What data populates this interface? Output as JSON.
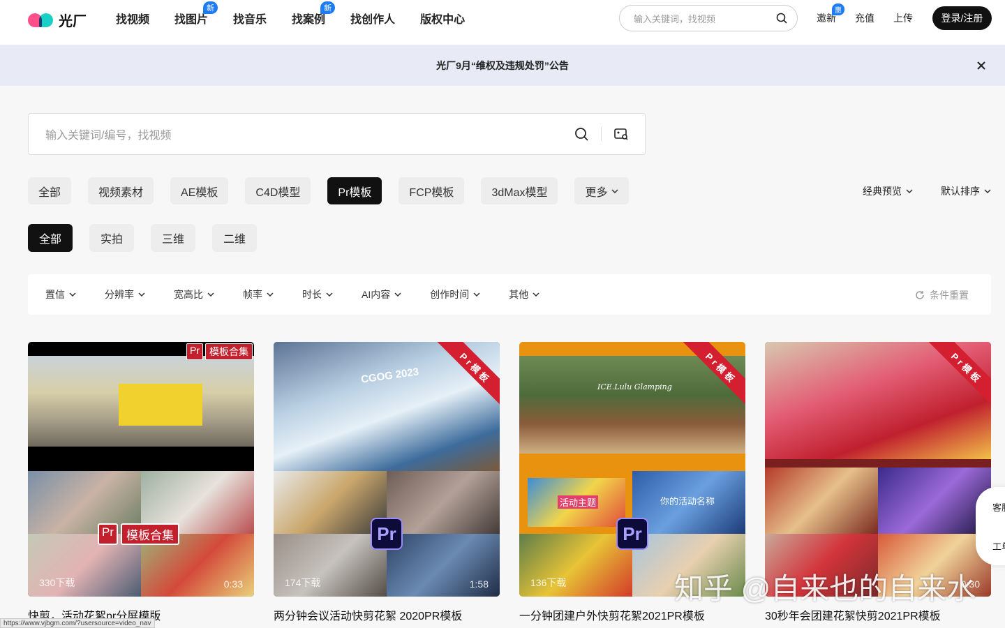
{
  "header": {
    "logo_text": "光厂",
    "nav": [
      {
        "label": "找视频",
        "badge": ""
      },
      {
        "label": "找图片",
        "badge": "新"
      },
      {
        "label": "找音乐",
        "badge": ""
      },
      {
        "label": "找案例",
        "badge": "新"
      },
      {
        "label": "找创作人",
        "badge": ""
      },
      {
        "label": "版权中心",
        "badge": ""
      }
    ],
    "search_placeholder": "输入关键词，找视频",
    "links": {
      "invite": "邀新",
      "invite_badge": "惠",
      "recharge": "充值",
      "upload": "上传"
    },
    "login_label": "登录/注册"
  },
  "notice": {
    "text": "光厂9月“维权及违规处罚”公告"
  },
  "main_search": {
    "placeholder": "输入关键词/编号，找视频"
  },
  "categories": {
    "items": [
      "全部",
      "视频素材",
      "AE模板",
      "C4D模型",
      "Pr模板",
      "FCP模板",
      "3dMax模型",
      "更多"
    ],
    "active": "Pr模板"
  },
  "sorts": {
    "preview": "经典预览",
    "order": "默认排序"
  },
  "subcategories": {
    "items": [
      "全部",
      "实拍",
      "三维",
      "二维"
    ],
    "active": "全部"
  },
  "filters": {
    "items": [
      "置信",
      "分辨率",
      "宽高比",
      "帧率",
      "时长",
      "AI内容",
      "创作时间",
      "其他"
    ],
    "reset": "条件重置"
  },
  "cards": [
    {
      "title": "快剪，活动花絮pr分屏模版",
      "downloads": "330下载",
      "duration": "0:33",
      "tag": "模板合集",
      "tag_pr": "Pr"
    },
    {
      "title": "两分钟会议活动快剪花絮 2020PR模板",
      "downloads": "174下载",
      "duration": "1:58",
      "ribbon": "Pr模板",
      "pr_icon": "Pr",
      "overlay_text": "CGOG 2023"
    },
    {
      "title": "一分钟团建户外快剪花絮2021PR模板",
      "downloads": "136下载",
      "duration": "",
      "ribbon": "Pr模板",
      "pr_icon": "Pr",
      "overlay_text_1": "活动主题",
      "overlay_text_2": "你的活动名称",
      "overlay_text_3": "ICE.Lulu Glamping"
    },
    {
      "title": "30秒年会团建花絮快剪2021PR模板",
      "downloads": "",
      "duration": "0:30",
      "ribbon": "Pr模板"
    }
  ],
  "side_float": {
    "service": "客服",
    "ticket": "工单"
  },
  "watermark": "知乎 @自来也的自来水",
  "status_url": "https://www.vjbgm.com/?usersource=video_nav"
}
